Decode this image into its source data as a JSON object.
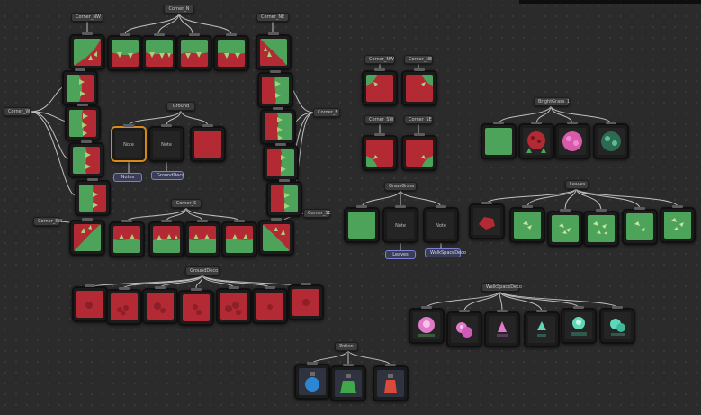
{
  "canvas": {
    "groups": {
      "corner_nw": "Corner_NW",
      "corner_n": "Corner_N",
      "corner_ne": "Corner_NE",
      "corner_w": "Corner_W",
      "ground": "Ground",
      "corner_e": "Corner_E",
      "corner_s": "Corner_S",
      "corner_sw": "Corner_SW",
      "corner_se": "Corner_SE",
      "ground_deco": "GroundDeco",
      "corner_nw2": "Corner_NW",
      "corner_ne2": "Corner_NE",
      "corner_sw2": "Corner_SW",
      "corner_se2": "Corner_SE",
      "grass_grass": "GrassGrass",
      "bright_grass": "BrightGrass_1",
      "leaves": "Leaves",
      "walkspace_deco": "WalkSpaceDeco",
      "potion": "Potion"
    },
    "nodes": {
      "ground_n1": "Note",
      "ground_n2": "Note",
      "grass_n1": "Note",
      "grass_n2": "Note"
    },
    "tags": {
      "ground_tag1": "Notes",
      "ground_tag2": "GroundDeco",
      "grass_tag1": "Leaves",
      "grass_tag2": "WalkSpaceDeco"
    }
  },
  "colors": {
    "red_tile": "#b32a34",
    "green_tile": "#4ea35a",
    "selection": "#d98a18",
    "tag_border": "#7d7fd4"
  }
}
